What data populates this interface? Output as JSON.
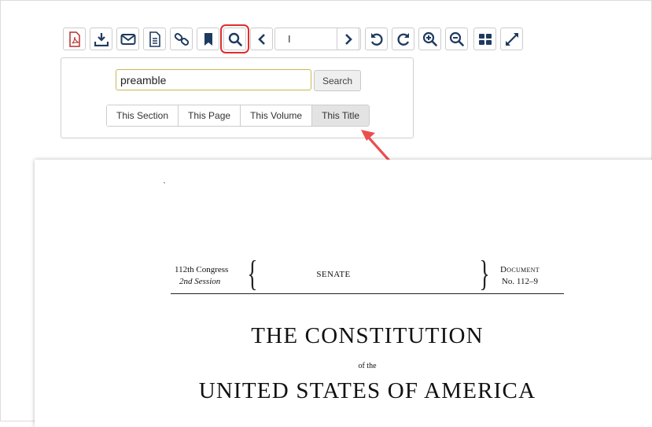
{
  "toolbar": {
    "buttons": [
      {
        "icon": "pdf-icon"
      },
      {
        "icon": "download-icon"
      },
      {
        "icon": "email-icon"
      },
      {
        "icon": "document-icon"
      },
      {
        "icon": "link-icon"
      },
      {
        "icon": "bookmark-icon"
      },
      {
        "icon": "search-icon",
        "active": true
      },
      {
        "icon": "chevron-left-icon"
      },
      {
        "icon": "chevron-right-icon"
      },
      {
        "icon": "rotate-left-icon"
      },
      {
        "icon": "rotate-right-icon"
      },
      {
        "icon": "zoom-in-icon"
      },
      {
        "icon": "zoom-out-icon"
      },
      {
        "icon": "grid-icon"
      },
      {
        "icon": "fullscreen-icon"
      }
    ],
    "page_select_value": "I",
    "highlight_color": "#e02d2d",
    "icon_color": "#1f3a5f"
  },
  "search": {
    "value": "preamble",
    "button_label": "Search",
    "scopes": [
      "This Section",
      "This Page",
      "This Volume",
      "This Title"
    ],
    "selected_scope": "This Title"
  },
  "annotation": {
    "arrow_color": "#ea4f4f"
  },
  "document": {
    "congress": "112th Congress",
    "session": "2nd Session",
    "chamber": "SENATE",
    "doc_word": "Document",
    "doc_number": "No. 112–9",
    "title_line1": "THE CONSTITUTION",
    "title_of": "of the",
    "title_line2": "UNITED STATES OF AMERICA"
  }
}
